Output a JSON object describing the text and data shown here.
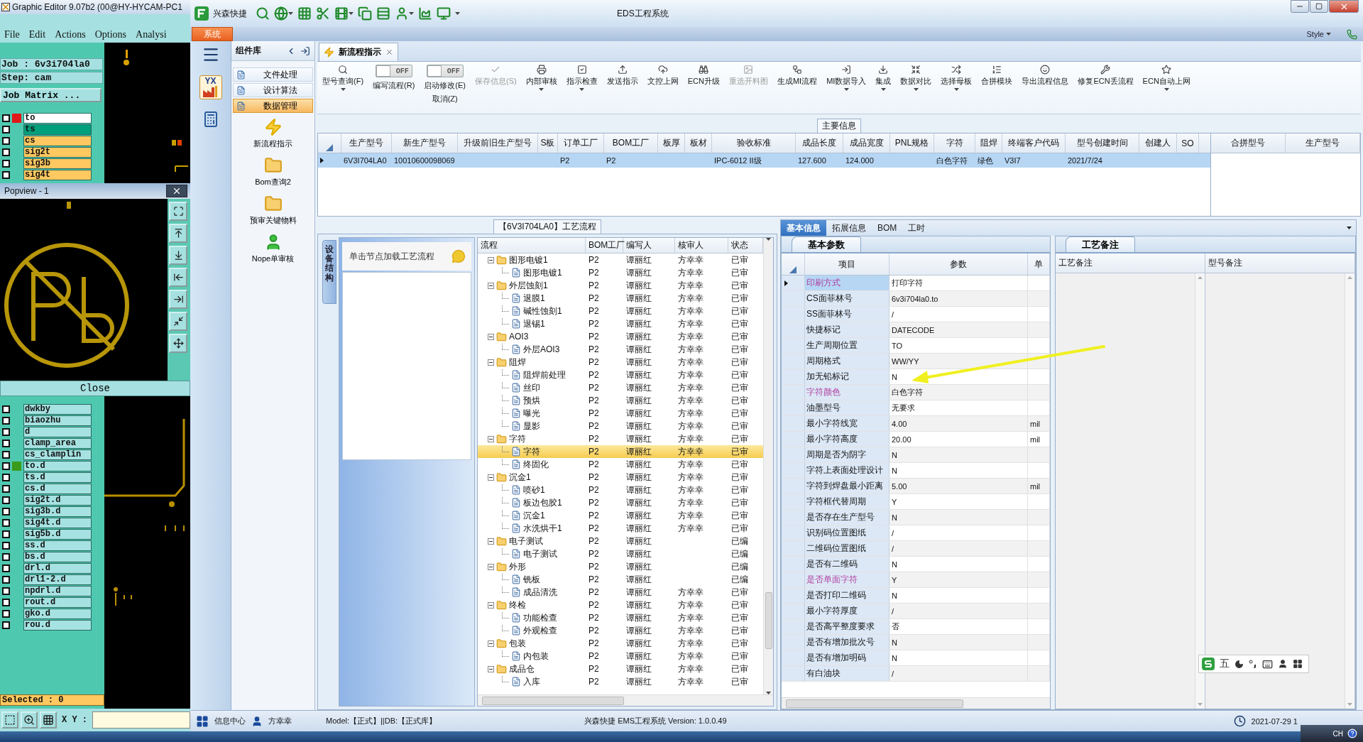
{
  "graphic_editor": {
    "title": "Graphic Editor 9.07b2 (00@HY-HYCAM-PC1",
    "menu": [
      "File",
      "Edit",
      "Actions",
      "Options",
      "Analysi"
    ],
    "job": "Job : 6v3i704la0",
    "step": "Step: cam",
    "job_matrix_button": "Job Matrix ...",
    "layers_top": [
      {
        "name": "to",
        "color": "#ffffff",
        "checked": false,
        "marker": {
          "color": "#e01818"
        }
      },
      {
        "name": "ts",
        "color": "#00a07c",
        "checked": false
      },
      {
        "name": "cs",
        "color": "#ffc860",
        "checked": false
      },
      {
        "name": "sig2t",
        "color": "#ffc860",
        "checked": false
      },
      {
        "name": "sig3b",
        "color": "#ffc860",
        "checked": false
      },
      {
        "name": "sig4t",
        "color": "#ffc860",
        "checked": false
      }
    ],
    "popview": {
      "title": "Popview - 1",
      "close_button": "Close"
    },
    "layers_bottom": [
      {
        "name": "dwkby",
        "color": "#a6e2e2",
        "checked": false
      },
      {
        "name": "biaozhu",
        "color": "#a6e2e2",
        "checked": false
      },
      {
        "name": "d",
        "color": "#a6e2e2",
        "checked": false
      },
      {
        "name": "clamp_area",
        "color": "#a6e2e2",
        "checked": false
      },
      {
        "name": "cs_clamplin",
        "color": "#a6e2e2",
        "checked": false
      },
      {
        "name": "to.d",
        "color": "#a6e2e2",
        "checked": false,
        "marker": {
          "color": "#3a9a1a"
        }
      },
      {
        "name": "ts.d",
        "color": "#a6e2e2",
        "checked": false
      },
      {
        "name": "cs.d",
        "color": "#a6e2e2",
        "checked": false
      },
      {
        "name": "sig2t.d",
        "color": "#a6e2e2",
        "checked": false
      },
      {
        "name": "sig3b.d",
        "color": "#a6e2e2",
        "checked": false
      },
      {
        "name": "sig4t.d",
        "color": "#a6e2e2",
        "checked": false
      },
      {
        "name": "sig5b.d",
        "color": "#a6e2e2",
        "checked": false
      },
      {
        "name": "ss.d",
        "color": "#a6e2e2",
        "checked": false
      },
      {
        "name": "bs.d",
        "color": "#a6e2e2",
        "checked": false
      },
      {
        "name": "drl.d",
        "color": "#a6e2e2",
        "checked": false
      },
      {
        "name": "drl1-2.d",
        "color": "#a6e2e2",
        "checked": false
      },
      {
        "name": "npdrl.d",
        "color": "#a6e2e2",
        "checked": false
      },
      {
        "name": "rout.d",
        "color": "#a6e2e2",
        "checked": false
      },
      {
        "name": "gko.d",
        "color": "#a6e2e2",
        "checked": false
      },
      {
        "name": "rou.d",
        "color": "#a6e2e2",
        "checked": false
      }
    ],
    "selected_status": "Selected : 0",
    "xy_label": "X Y :"
  },
  "eds": {
    "app_name": "兴森快捷",
    "title": "EDS工程系统",
    "ribbon_tab": "系统",
    "style_label": "Style",
    "strip_logo": "YX",
    "nav": {
      "title": "组件库",
      "items": [
        {
          "label": "文件处理",
          "selected": false
        },
        {
          "label": "设计算法",
          "selected": false
        },
        {
          "label": "数据管理",
          "selected": true
        }
      ],
      "tiles": [
        "新流程指示",
        "Bom查询2",
        "预审关键物料",
        "Nope单审核"
      ]
    },
    "doc_tab": "新流程指示",
    "toolbar": [
      {
        "kind": "button",
        "label": "型号查询(F)",
        "dropdown": true,
        "disabled": false
      },
      {
        "kind": "toggle",
        "switch_text": "OFF",
        "on": false,
        "label": "编写流程(R)"
      },
      {
        "kind": "toggle",
        "switch_text": "OFF",
        "on": false,
        "label": "启动修改(E)",
        "sublabel": "取消(Z)"
      },
      {
        "kind": "button",
        "label": "保存信息(S)",
        "dropdown": false,
        "disabled": true
      },
      {
        "kind": "button",
        "label": "内部审核",
        "dropdown": true,
        "disabled": false
      },
      {
        "kind": "button",
        "label": "指示检查",
        "dropdown": true,
        "disabled": false
      },
      {
        "kind": "button",
        "label": "发送指示",
        "dropdown": false,
        "disabled": false
      },
      {
        "kind": "button",
        "label": "文控上网",
        "dropdown": false,
        "disabled": false
      },
      {
        "kind": "button",
        "label": "ECN升级",
        "dropdown": false,
        "disabled": false
      },
      {
        "kind": "button",
        "label": "重选开料图",
        "dropdown": false,
        "disabled": true
      },
      {
        "kind": "button",
        "label": "生成MI流程",
        "dropdown": false,
        "disabled": false
      },
      {
        "kind": "button",
        "label": "MI数据导入",
        "dropdown": true,
        "disabled": false
      },
      {
        "kind": "button",
        "label": "集成",
        "dropdown": true,
        "disabled": false
      },
      {
        "kind": "button",
        "label": "数据对比",
        "dropdown": true,
        "disabled": false
      },
      {
        "kind": "button",
        "label": "选择母板",
        "dropdown": true,
        "disabled": false
      },
      {
        "kind": "button",
        "label": "合拼模块",
        "dropdown": false,
        "disabled": false
      },
      {
        "kind": "button",
        "label": "导出流程信息",
        "dropdown": false,
        "disabled": false
      },
      {
        "kind": "button",
        "label": "修复ECN丢流程",
        "dropdown": false,
        "disabled": false
      },
      {
        "kind": "button",
        "label": "ECN自动上网",
        "dropdown": true,
        "disabled": false
      }
    ],
    "main_info": {
      "title": "主要信息",
      "columns": [
        "生产型号",
        "新生产型号",
        "升级前旧生产型号",
        "S板",
        "订单工厂",
        "BOM工厂",
        "板厚",
        "板材",
        "验收标准",
        "成品长度",
        "成品宽度",
        "PNL规格",
        "字符",
        "阻焊",
        "终端客户代码",
        "型号创建时间",
        "创建人",
        "SO"
      ],
      "rows": [
        {
          "selected": true,
          "cells": [
            "6V3I704LA0",
            "10010600098069",
            "",
            "",
            "P2",
            "P2",
            "",
            "",
            "IPC-6012 II级",
            "127.600",
            "124.000",
            "",
            "白色字符",
            "绿色",
            "V3I7",
            "2021/7/24",
            "",
            ""
          ]
        }
      ],
      "side_columns": [
        "合拼型号",
        "生产型号"
      ]
    },
    "process": {
      "title": "【6V3I704LA0】工艺流程",
      "side_tab": "设备结构",
      "hint": "单击节点加载工艺流程",
      "columns": [
        "流程",
        "BOM工厂",
        "编写人",
        "核审人",
        "状态"
      ],
      "tree": [
        {
          "name": "图形电镀1",
          "bom": "P2",
          "writer": "谭丽红",
          "reviewer": "方幸幸",
          "status": "已审",
          "expanded": true,
          "selected": false,
          "children": [
            {
              "name": "图形电镀1",
              "bom": "P2",
              "writer": "谭丽红",
              "reviewer": "方幸幸",
              "status": "已审",
              "selected": false
            }
          ]
        },
        {
          "name": "外层蚀刻1",
          "bom": "P2",
          "writer": "谭丽红",
          "reviewer": "方幸幸",
          "status": "已审",
          "expanded": true,
          "selected": false,
          "children": [
            {
              "name": "退膜1",
              "bom": "P2",
              "writer": "谭丽红",
              "reviewer": "方幸幸",
              "status": "已审",
              "selected": false
            },
            {
              "name": "碱性蚀刻1",
              "bom": "P2",
              "writer": "谭丽红",
              "reviewer": "方幸幸",
              "status": "已审",
              "selected": false
            },
            {
              "name": "退锡1",
              "bom": "P2",
              "writer": "谭丽红",
              "reviewer": "方幸幸",
              "status": "已审",
              "selected": false
            }
          ]
        },
        {
          "name": "AOI3",
          "bom": "P2",
          "writer": "谭丽红",
          "reviewer": "方幸幸",
          "status": "已审",
          "expanded": true,
          "selected": false,
          "children": [
            {
              "name": "外层AOI3",
              "bom": "P2",
              "writer": "谭丽红",
              "reviewer": "方幸幸",
              "status": "已审",
              "selected": false
            }
          ]
        },
        {
          "name": "阻焊",
          "bom": "P2",
          "writer": "谭丽红",
          "reviewer": "方幸幸",
          "status": "已审",
          "expanded": true,
          "selected": false,
          "children": [
            {
              "name": "阻焊前处理",
              "bom": "P2",
              "writer": "谭丽红",
              "reviewer": "方幸幸",
              "status": "已审",
              "selected": false
            },
            {
              "name": "丝印",
              "bom": "P2",
              "writer": "谭丽红",
              "reviewer": "方幸幸",
              "status": "已审",
              "selected": false
            },
            {
              "name": "预烘",
              "bom": "P2",
              "writer": "谭丽红",
              "reviewer": "方幸幸",
              "status": "已审",
              "selected": false
            },
            {
              "name": "曝光",
              "bom": "P2",
              "writer": "谭丽红",
              "reviewer": "方幸幸",
              "status": "已审",
              "selected": false
            },
            {
              "name": "显影",
              "bom": "P2",
              "writer": "谭丽红",
              "reviewer": "方幸幸",
              "status": "已审",
              "selected": false
            }
          ]
        },
        {
          "name": "字符",
          "bom": "P2",
          "writer": "谭丽红",
          "reviewer": "方幸幸",
          "status": "已审",
          "expanded": true,
          "selected": false,
          "children": [
            {
              "name": "字符",
              "bom": "P2",
              "writer": "谭丽红",
              "reviewer": "方幸幸",
              "status": "已审",
              "selected": true
            },
            {
              "name": "终固化",
              "bom": "P2",
              "writer": "谭丽红",
              "reviewer": "方幸幸",
              "status": "已审",
              "selected": false
            }
          ]
        },
        {
          "name": "沉金1",
          "bom": "P2",
          "writer": "谭丽红",
          "reviewer": "方幸幸",
          "status": "已审",
          "expanded": true,
          "selected": false,
          "children": [
            {
              "name": "喷砂1",
              "bom": "P2",
              "writer": "谭丽红",
              "reviewer": "方幸幸",
              "status": "已审",
              "selected": false
            },
            {
              "name": "板边包胶1",
              "bom": "P2",
              "writer": "谭丽红",
              "reviewer": "方幸幸",
              "status": "已审",
              "selected": false
            },
            {
              "name": "沉金1",
              "bom": "P2",
              "writer": "谭丽红",
              "reviewer": "方幸幸",
              "status": "已审",
              "selected": false
            },
            {
              "name": "水洗烘干1",
              "bom": "P2",
              "writer": "谭丽红",
              "reviewer": "方幸幸",
              "status": "已审",
              "selected": false
            }
          ]
        },
        {
          "name": "电子测试",
          "bom": "P2",
          "writer": "谭丽红",
          "status": "已编",
          "expanded": true,
          "selected": false,
          "children": [
            {
              "name": "电子测试",
              "bom": "P2",
              "writer": "谭丽红",
              "status": "已编",
              "selected": false
            }
          ]
        },
        {
          "name": "外形",
          "bom": "P2",
          "writer": "谭丽红",
          "status": "已编",
          "expanded": true,
          "selected": false,
          "children": [
            {
              "name": "铣板",
              "bom": "P2",
              "writer": "谭丽红",
              "status": "已编",
              "selected": false
            },
            {
              "name": "成品清洗",
              "bom": "P2",
              "writer": "谭丽红",
              "reviewer": "方幸幸",
              "status": "已审",
              "selected": false
            }
          ]
        },
        {
          "name": "终检",
          "bom": "P2",
          "writer": "谭丽红",
          "reviewer": "方幸幸",
          "status": "已审",
          "expanded": true,
          "selected": false,
          "children": [
            {
              "name": "功能检查",
              "bom": "P2",
              "writer": "谭丽红",
              "reviewer": "方幸幸",
              "status": "已审",
              "selected": false
            },
            {
              "name": "外观检查",
              "bom": "P2",
              "writer": "谭丽红",
              "reviewer": "方幸幸",
              "status": "已审",
              "selected": false
            }
          ]
        },
        {
          "name": "包装",
          "bom": "P2",
          "writer": "谭丽红",
          "reviewer": "方幸幸",
          "status": "已审",
          "expanded": true,
          "selected": false,
          "children": [
            {
              "name": "内包装",
              "bom": "P2",
              "writer": "谭丽红",
              "reviewer": "方幸幸",
              "status": "已审",
              "selected": false
            }
          ]
        },
        {
          "name": "成品仓",
          "bom": "P2",
          "writer": "谭丽红",
          "reviewer": "方幸幸",
          "status": "已审",
          "expanded": true,
          "selected": false,
          "children": [
            {
              "name": "入库",
              "bom": "P2",
              "writer": "谭丽红",
              "reviewer": "方幸幸",
              "status": "已审",
              "selected": false
            }
          ]
        }
      ]
    },
    "detail_tabs": [
      {
        "label": "基本信息",
        "selected": true
      },
      {
        "label": "拓展信息",
        "selected": false
      },
      {
        "label": "BOM",
        "selected": false
      },
      {
        "label": "工时",
        "selected": false
      }
    ],
    "params": {
      "tab": "基本参数",
      "columns": [
        "项目",
        "参数",
        "单"
      ],
      "rows": [
        {
          "item": "印刷方式",
          "value": "打印字符",
          "flagged": true,
          "selected": true
        },
        {
          "item": "CS面菲林号",
          "value": "6v3i704la0.to",
          "flagged": false,
          "selected": false
        },
        {
          "item": "SS面菲林号",
          "value": "/",
          "flagged": false,
          "selected": false
        },
        {
          "item": "快捷标记",
          "value": "DATECODE",
          "flagged": false,
          "selected": false
        },
        {
          "item": "生产周期位置",
          "value": "TO",
          "flagged": false,
          "selected": false
        },
        {
          "item": "周期格式",
          "value": "WW/YY",
          "flagged": false,
          "selected": false
        },
        {
          "item": "加无铅标记",
          "value": "N",
          "flagged": false,
          "selected": false
        },
        {
          "item": "字符颜色",
          "value": "白色字符",
          "flagged": true,
          "selected": false
        },
        {
          "item": "油墨型号",
          "value": "无要求",
          "flagged": false,
          "selected": false
        },
        {
          "item": "最小字符线宽",
          "value": "4.00",
          "unit": "mil",
          "flagged": false,
          "selected": false
        },
        {
          "item": "最小字符高度",
          "value": "20.00",
          "unit": "mil",
          "flagged": false,
          "selected": false
        },
        {
          "item": "周期是否为阴字",
          "value": "N",
          "flagged": false,
          "selected": false
        },
        {
          "item": "字符上表面处理设计",
          "value": "N",
          "flagged": false,
          "selected": false
        },
        {
          "item": "字符到焊盘最小距离",
          "value": "5.00",
          "unit": "mil",
          "flagged": false,
          "selected": false
        },
        {
          "item": "字符框代替周期",
          "value": "Y",
          "flagged": false,
          "selected": false
        },
        {
          "item": "是否存在生产型号",
          "value": "N",
          "flagged": false,
          "selected": false
        },
        {
          "item": "识别码位置图纸",
          "value": "/",
          "flagged": false,
          "selected": false
        },
        {
          "item": "二维码位置图纸",
          "value": "/",
          "flagged": false,
          "selected": false
        },
        {
          "item": "是否有二维码",
          "value": "N",
          "flagged": false,
          "selected": false
        },
        {
          "item": "是否单面字符",
          "value": "Y",
          "flagged": true,
          "selected": false
        },
        {
          "item": "是否打印二维码",
          "value": "N",
          "flagged": false,
          "selected": false
        },
        {
          "item": "最小字符厚度",
          "value": "/",
          "flagged": false,
          "selected": false
        },
        {
          "item": "是否高平整度要求",
          "value": "否",
          "flagged": false,
          "selected": false
        },
        {
          "item": "是否有增加批次号",
          "value": "N",
          "flagged": false,
          "selected": false
        },
        {
          "item": "是否有增加明码",
          "value": "N",
          "flagged": false,
          "selected": false
        },
        {
          "item": "有白油块",
          "value": "/",
          "flagged": false,
          "selected": false
        }
      ]
    },
    "remarks": {
      "tab": "工艺备注",
      "columns": [
        "工艺备注",
        "型号备注"
      ]
    },
    "ime_mode": "五",
    "status_bar": {
      "info_center": "信息中心",
      "user": "方幸幸",
      "model": "Model:【正式】||DB:【正式库】",
      "version": "兴森快捷 EMS工程系统 Version: 1.0.0.49",
      "datetime": "2021-07-29 1"
    }
  },
  "taskbar": {
    "language": "CH"
  }
}
